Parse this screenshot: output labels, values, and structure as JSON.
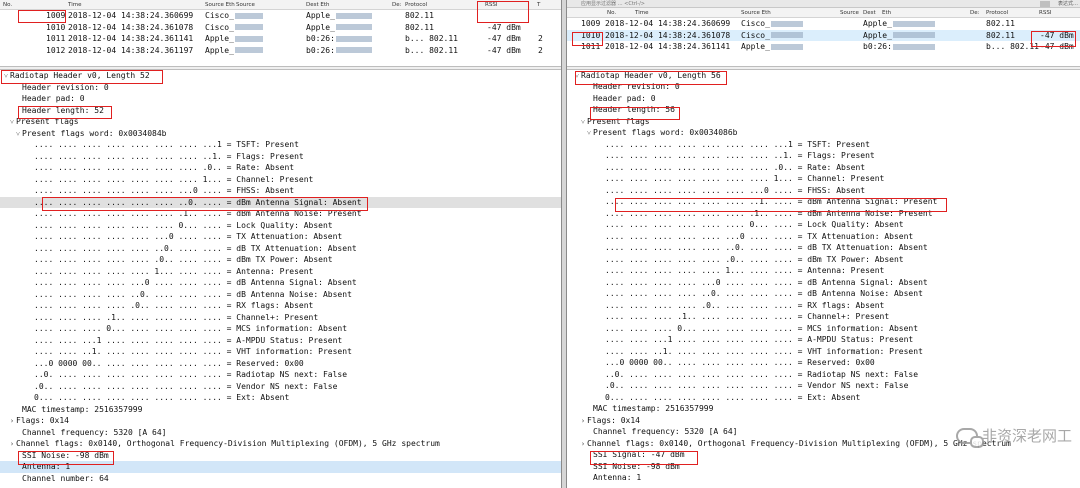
{
  "left": {
    "columns": [
      "No.",
      "Time",
      "Source Eth",
      "Source",
      "Dest Eth",
      "De:",
      "Protocol",
      "RSSI",
      "T"
    ],
    "packets": [
      {
        "no": "1009",
        "time": "2018-12-04 14:38:24.360699",
        "src": "Cisco_",
        "dst": "Apple_",
        "proto": "802.11",
        "rssi": "",
        "extra": "",
        "selected": false
      },
      {
        "no": "1010",
        "time": "2018-12-04 14:38:24.361078",
        "src": "Cisco_",
        "dst": "Apple_",
        "proto": "802.11",
        "rssi": "-47 dBm",
        "extra": "",
        "selected": false
      },
      {
        "no": "1011",
        "time": "2018-12-04 14:38:24.361141",
        "src": "Apple_",
        "dst": "b0:26:",
        "proto": "b... 802.11",
        "rssi": "-47 dBm",
        "extra": "2",
        "selected": false
      },
      {
        "no": "1012",
        "time": "2018-12-04 14:38:24.361197",
        "src": "Apple_",
        "dst": "b0:26:",
        "proto": "b... 802.11",
        "rssi": "-47 dBm",
        "extra": "2",
        "selected": false
      }
    ],
    "tree": [
      {
        "indent": 0,
        "tw": "v",
        "text": "Radiotap Header v0, Length 52",
        "hl": ""
      },
      {
        "indent": 2,
        "tw": "",
        "text": "Header revision: 0",
        "hl": ""
      },
      {
        "indent": 2,
        "tw": "",
        "text": "Header pad: 0",
        "hl": ""
      },
      {
        "indent": 2,
        "tw": "",
        "text": "Header length: 52",
        "hl": ""
      },
      {
        "indent": 1,
        "tw": "v",
        "text": "Present flags",
        "hl": ""
      },
      {
        "indent": 2,
        "tw": "v",
        "text": "Present flags word: 0x0034084b",
        "hl": ""
      },
      {
        "indent": 4,
        "tw": "",
        "text": ".... .... .... .... .... .... .... ...1 = TSFT: Present",
        "hl": ""
      },
      {
        "indent": 4,
        "tw": "",
        "text": ".... .... .... .... .... .... .... ..1. = Flags: Present",
        "hl": ""
      },
      {
        "indent": 4,
        "tw": "",
        "text": ".... .... .... .... .... .... .... .0.. = Rate: Absent",
        "hl": ""
      },
      {
        "indent": 4,
        "tw": "",
        "text": ".... .... .... .... .... .... .... 1... = Channel: Present",
        "hl": ""
      },
      {
        "indent": 4,
        "tw": "",
        "text": ".... .... .... .... .... .... ...0 .... = FHSS: Absent",
        "hl": ""
      },
      {
        "indent": 4,
        "tw": "",
        "text": ".... .... .... .... .... .... ..0. .... = dBm Antenna Signal: Absent",
        "hl": "hl"
      },
      {
        "indent": 4,
        "tw": "",
        "text": ".... .... .... .... .... .... .1.. .... = dBm Antenna Noise: Present",
        "hl": ""
      },
      {
        "indent": 4,
        "tw": "",
        "text": ".... .... .... .... .... .... 0... .... = Lock Quality: Absent",
        "hl": ""
      },
      {
        "indent": 4,
        "tw": "",
        "text": ".... .... .... .... .... ...0 .... .... = TX Attenuation: Absent",
        "hl": ""
      },
      {
        "indent": 4,
        "tw": "",
        "text": ".... .... .... .... .... ..0. .... .... = dB TX Attenuation: Absent",
        "hl": ""
      },
      {
        "indent": 4,
        "tw": "",
        "text": ".... .... .... .... .... .0.. .... .... = dBm TX Power: Absent",
        "hl": ""
      },
      {
        "indent": 4,
        "tw": "",
        "text": ".... .... .... .... .... 1... .... .... = Antenna: Present",
        "hl": ""
      },
      {
        "indent": 4,
        "tw": "",
        "text": ".... .... .... .... ...0 .... .... .... = dB Antenna Signal: Absent",
        "hl": ""
      },
      {
        "indent": 4,
        "tw": "",
        "text": ".... .... .... .... ..0. .... .... .... = dB Antenna Noise: Absent",
        "hl": ""
      },
      {
        "indent": 4,
        "tw": "",
        "text": ".... .... .... .... .0.. .... .... .... = RX flags: Absent",
        "hl": ""
      },
      {
        "indent": 4,
        "tw": "",
        "text": ".... .... .... .1.. .... .... .... .... = Channel+: Present",
        "hl": ""
      },
      {
        "indent": 4,
        "tw": "",
        "text": ".... .... .... 0... .... .... .... .... = MCS information: Absent",
        "hl": ""
      },
      {
        "indent": 4,
        "tw": "",
        "text": ".... .... ...1 .... .... .... .... .... = A-MPDU Status: Present",
        "hl": ""
      },
      {
        "indent": 4,
        "tw": "",
        "text": ".... .... ..1. .... .... .... .... .... = VHT information: Present",
        "hl": ""
      },
      {
        "indent": 4,
        "tw": "",
        "text": "...0 0000 00.. .... .... .... .... .... = Reserved: 0x00",
        "hl": ""
      },
      {
        "indent": 4,
        "tw": "",
        "text": "..0. .... .... .... .... .... .... .... = Radiotap NS next: False",
        "hl": ""
      },
      {
        "indent": 4,
        "tw": "",
        "text": ".0.. .... .... .... .... .... .... .... = Vendor NS next: False",
        "hl": ""
      },
      {
        "indent": 4,
        "tw": "",
        "text": "0... .... .... .... .... .... .... .... = Ext: Absent",
        "hl": ""
      },
      {
        "indent": 2,
        "tw": "",
        "text": "MAC timestamp: 2516357999",
        "hl": ""
      },
      {
        "indent": 1,
        "tw": ">",
        "text": "Flags: 0x14",
        "hl": ""
      },
      {
        "indent": 2,
        "tw": "",
        "text": "Channel frequency: 5320 [A 64]",
        "hl": ""
      },
      {
        "indent": 1,
        "tw": ">",
        "text": "Channel flags: 0x0140, Orthogonal Frequency-Division Multiplexing (OFDM), 5 GHz spectrum",
        "hl": ""
      },
      {
        "indent": 2,
        "tw": "",
        "text": "SSI Noise: -98 dBm",
        "hl": ""
      },
      {
        "indent": 2,
        "tw": "",
        "text": "Antenna: 1",
        "hl": "hl2"
      },
      {
        "indent": 2,
        "tw": "",
        "text": "Channel number: 64",
        "hl": ""
      }
    ]
  },
  "right": {
    "filter_text": "应用显示过滤器 … <Ctrl-/>",
    "filter_btn": "表达式…",
    "columns": [
      "No.",
      "Time",
      "Source Eth",
      "Source",
      "Dest",
      "Eth",
      "De:",
      "Protocol",
      "RSSI"
    ],
    "packets": [
      {
        "no": "1009",
        "time": "2018-12-04 14:38:24.360699",
        "src": "Cisco_",
        "dst": "Apple_",
        "proto": "802.11",
        "rssi": "",
        "selected": false
      },
      {
        "no": "1010",
        "time": "2018-12-04 14:38:24.361078",
        "src": "Cisco_",
        "dst": "Apple_",
        "proto": "802.11",
        "rssi": "-47 dBm",
        "selected": true
      },
      {
        "no": "1011",
        "time": "2018-12-04 14:38:24.361141",
        "src": "Apple_",
        "dst": "b0:26:",
        "proto": "b... 802.11",
        "rssi": "-47 dBm",
        "selected": false
      }
    ],
    "tree": [
      {
        "indent": 0,
        "tw": "v",
        "text": "Radiotap Header v0, Length 56",
        "hl": ""
      },
      {
        "indent": 2,
        "tw": "",
        "text": "Header revision: 0",
        "hl": ""
      },
      {
        "indent": 2,
        "tw": "",
        "text": "Header pad: 0",
        "hl": ""
      },
      {
        "indent": 2,
        "tw": "",
        "text": "Header length: 56",
        "hl": ""
      },
      {
        "indent": 1,
        "tw": "v",
        "text": "Present flags",
        "hl": ""
      },
      {
        "indent": 2,
        "tw": "v",
        "text": "Present flags word: 0x0034086b",
        "hl": ""
      },
      {
        "indent": 4,
        "tw": "",
        "text": ".... .... .... .... .... .... .... ...1 = TSFT: Present",
        "hl": ""
      },
      {
        "indent": 4,
        "tw": "",
        "text": ".... .... .... .... .... .... .... ..1. = Flags: Present",
        "hl": ""
      },
      {
        "indent": 4,
        "tw": "",
        "text": ".... .... .... .... .... .... .... .0.. = Rate: Absent",
        "hl": ""
      },
      {
        "indent": 4,
        "tw": "",
        "text": ".... .... .... .... .... .... .... 1... = Channel: Present",
        "hl": ""
      },
      {
        "indent": 4,
        "tw": "",
        "text": ".... .... .... .... .... .... ...0 .... = FHSS: Absent",
        "hl": ""
      },
      {
        "indent": 4,
        "tw": "",
        "text": ".... .... .... .... .... .... ..1. .... = dBm Antenna Signal: Present",
        "hl": ""
      },
      {
        "indent": 4,
        "tw": "",
        "text": ".... .... .... .... .... .... .1.. .... = dBm Antenna Noise: Present",
        "hl": ""
      },
      {
        "indent": 4,
        "tw": "",
        "text": ".... .... .... .... .... .... 0... .... = Lock Quality: Absent",
        "hl": ""
      },
      {
        "indent": 4,
        "tw": "",
        "text": ".... .... .... .... .... ...0 .... .... = TX Attenuation: Absent",
        "hl": ""
      },
      {
        "indent": 4,
        "tw": "",
        "text": ".... .... .... .... .... ..0. .... .... = dB TX Attenuation: Absent",
        "hl": ""
      },
      {
        "indent": 4,
        "tw": "",
        "text": ".... .... .... .... .... .0.. .... .... = dBm TX Power: Absent",
        "hl": ""
      },
      {
        "indent": 4,
        "tw": "",
        "text": ".... .... .... .... .... 1... .... .... = Antenna: Present",
        "hl": ""
      },
      {
        "indent": 4,
        "tw": "",
        "text": ".... .... .... .... ...0 .... .... .... = dB Antenna Signal: Absent",
        "hl": ""
      },
      {
        "indent": 4,
        "tw": "",
        "text": ".... .... .... .... ..0. .... .... .... = dB Antenna Noise: Absent",
        "hl": ""
      },
      {
        "indent": 4,
        "tw": "",
        "text": ".... .... .... .... .0.. .... .... .... = RX flags: Absent",
        "hl": ""
      },
      {
        "indent": 4,
        "tw": "",
        "text": ".... .... .... .1.. .... .... .... .... = Channel+: Present",
        "hl": ""
      },
      {
        "indent": 4,
        "tw": "",
        "text": ".... .... .... 0... .... .... .... .... = MCS information: Absent",
        "hl": ""
      },
      {
        "indent": 4,
        "tw": "",
        "text": ".... .... ...1 .... .... .... .... .... = A-MPDU Status: Present",
        "hl": ""
      },
      {
        "indent": 4,
        "tw": "",
        "text": ".... .... ..1. .... .... .... .... .... = VHT information: Present",
        "hl": ""
      },
      {
        "indent": 4,
        "tw": "",
        "text": "...0 0000 00.. .... .... .... .... .... = Reserved: 0x00",
        "hl": ""
      },
      {
        "indent": 4,
        "tw": "",
        "text": "..0. .... .... .... .... .... .... .... = Radiotap NS next: False",
        "hl": ""
      },
      {
        "indent": 4,
        "tw": "",
        "text": ".0.. .... .... .... .... .... .... .... = Vendor NS next: False",
        "hl": ""
      },
      {
        "indent": 4,
        "tw": "",
        "text": "0... .... .... .... .... .... .... .... = Ext: Absent",
        "hl": ""
      },
      {
        "indent": 2,
        "tw": "",
        "text": "MAC timestamp: 2516357999",
        "hl": ""
      },
      {
        "indent": 1,
        "tw": ">",
        "text": "Flags: 0x14",
        "hl": ""
      },
      {
        "indent": 2,
        "tw": "",
        "text": "Channel frequency: 5320 [A 64]",
        "hl": ""
      },
      {
        "indent": 1,
        "tw": ">",
        "text": "Channel flags: 0x0140, Orthogonal Frequency-Division Multiplexing (OFDM), 5 GHz spectrum",
        "hl": ""
      },
      {
        "indent": 2,
        "tw": "",
        "text": "SSI Signal: -47 dBm",
        "hl": ""
      },
      {
        "indent": 2,
        "tw": "",
        "text": "SSI Noise: -98 dBm",
        "hl": ""
      },
      {
        "indent": 2,
        "tw": "",
        "text": "Antenna: 1",
        "hl": ""
      }
    ]
  },
  "watermark": {
    "text": "非资深老网工",
    "icon": "wechat-icon"
  },
  "colors": {
    "highlight_box": "#e02020",
    "selected_row": "#dbeefc"
  }
}
